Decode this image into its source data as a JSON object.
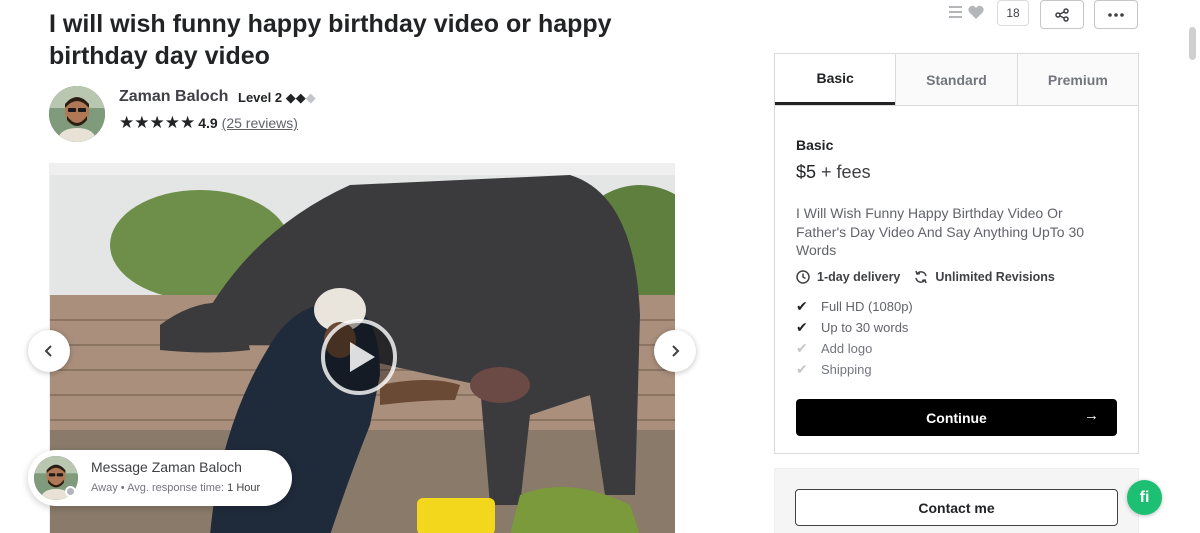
{
  "gig": {
    "title": "I will wish funny happy birthday video or happy birthday day video"
  },
  "seller": {
    "name": "Zaman Baloch",
    "level": "Level 2",
    "level_diamonds": "◆◆",
    "level_diamond_dim": "◆",
    "stars": "★★★★★",
    "rating": "4.9",
    "reviews": "(25 reviews)"
  },
  "message": {
    "title": "Message Zaman Baloch",
    "status": "Away",
    "separator": "•",
    "response_label": "Avg. response time:",
    "response_value": "1 Hour"
  },
  "actions": {
    "save_count": "18"
  },
  "package": {
    "tabs": [
      "Basic",
      "Standard",
      "Premium"
    ],
    "active_tab": "Basic",
    "name": "Basic",
    "price": "$5",
    "fees": "+ fees",
    "description": "I Will Wish Funny Happy Birthday Video Or Father's Day Video And Say Anything UpTo 30 Words",
    "delivery": "1-day delivery",
    "revisions": "Unlimited Revisions",
    "features": [
      {
        "label": "Full HD (1080p)",
        "included": true
      },
      {
        "label": "Up to 30 words",
        "included": true
      },
      {
        "label": "Add logo",
        "included": false
      },
      {
        "label": "Shipping",
        "included": false
      }
    ],
    "continue_label": "Continue",
    "continue_arrow": "→"
  },
  "contact": {
    "label": "Contact me"
  },
  "badge": {
    "text": "fi"
  },
  "icons": {
    "prev": "chevron-left-icon",
    "next": "chevron-right-icon",
    "share": "share-icon",
    "more": "more-icon",
    "collect": "list-icon",
    "heart": "heart-icon",
    "clock": "clock-icon",
    "refresh": "refresh-icon",
    "check": "check-icon"
  },
  "colors": {
    "brand_green": "#1dbf73",
    "continue_bg": "#000000",
    "text_dark": "#222325"
  }
}
